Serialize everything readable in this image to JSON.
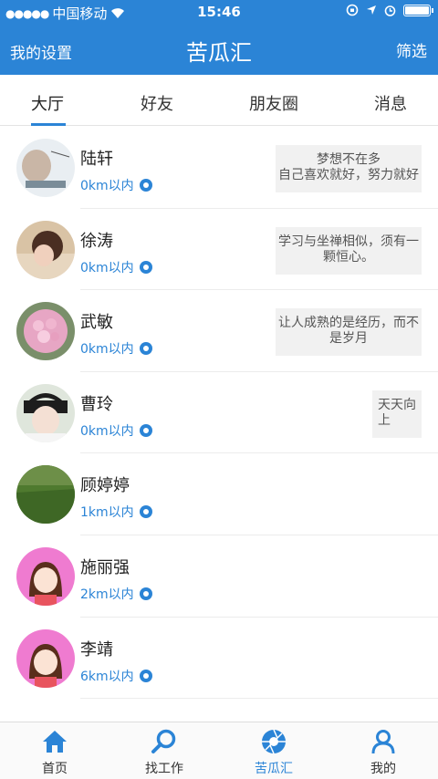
{
  "status": {
    "carrier": "中国移动",
    "time": "15:46"
  },
  "nav": {
    "left": "我的设置",
    "title": "苦瓜汇",
    "right": "筛选"
  },
  "tabs": [
    "大厅",
    "好友",
    "朋友圈",
    "消息"
  ],
  "users": [
    {
      "name": "陆轩",
      "distance": "0km以内",
      "motto": "梦想不在多\n自己喜欢就好，努力就好"
    },
    {
      "name": "徐涛",
      "distance": "0km以内",
      "motto": "学习与坐禅相似，须有一颗恒心。"
    },
    {
      "name": "武敏",
      "distance": "0km以内",
      "motto": "让人成熟的是经历，而不是岁月"
    },
    {
      "name": "曹玲",
      "distance": "0km以内",
      "motto": "天天向上"
    },
    {
      "name": "顾婷婷",
      "distance": "1km以内",
      "motto": ""
    },
    {
      "name": "施丽强",
      "distance": "2km以内",
      "motto": ""
    },
    {
      "name": "李靖",
      "distance": "6km以内",
      "motto": ""
    }
  ],
  "tabbar": [
    "首页",
    "找工作",
    "苦瓜汇",
    "我的"
  ],
  "colors": {
    "accent": "#2b84d6"
  }
}
